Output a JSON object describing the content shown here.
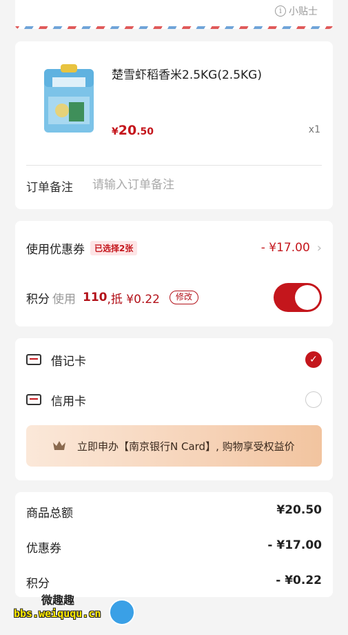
{
  "top": {
    "tip_icon": "info-icon",
    "tip_label": "小贴士"
  },
  "product": {
    "name": "楚雪虾稻香米2.5KG(2.5KG)",
    "price_currency": "¥",
    "price_int": "20",
    "price_dec": ".50",
    "quantity": "x1",
    "remark_label": "订单备注",
    "remark_placeholder": "请输入订单备注"
  },
  "discount": {
    "coupon_label": "使用优惠券",
    "coupon_badge": "已选择2张",
    "coupon_amount": "- ¥17.00",
    "points_label": "积分",
    "points_use": "使用",
    "points_value": "110",
    "points_offset": ",抵 ¥0.22",
    "modify_label": "修改",
    "points_toggle_on": true
  },
  "payment": {
    "options": [
      {
        "label": "借记卡",
        "checked": true
      },
      {
        "label": "信用卡",
        "checked": false
      }
    ],
    "promo_text": "立即申办【南京银行N Card】, 购物享受权益价"
  },
  "summary": {
    "rows": [
      {
        "label": "商品总额",
        "value": "¥20.50"
      },
      {
        "label": "优惠券",
        "value": "- ¥17.00"
      },
      {
        "label": "积分",
        "value": "- ¥0.22"
      }
    ]
  },
  "watermark": {
    "title": "微趣趣",
    "url": "bbs.weiququ.cn"
  },
  "colors": {
    "accent": "#c4161c",
    "background": "#f4f4f4",
    "promo": "#f6d3b8"
  }
}
